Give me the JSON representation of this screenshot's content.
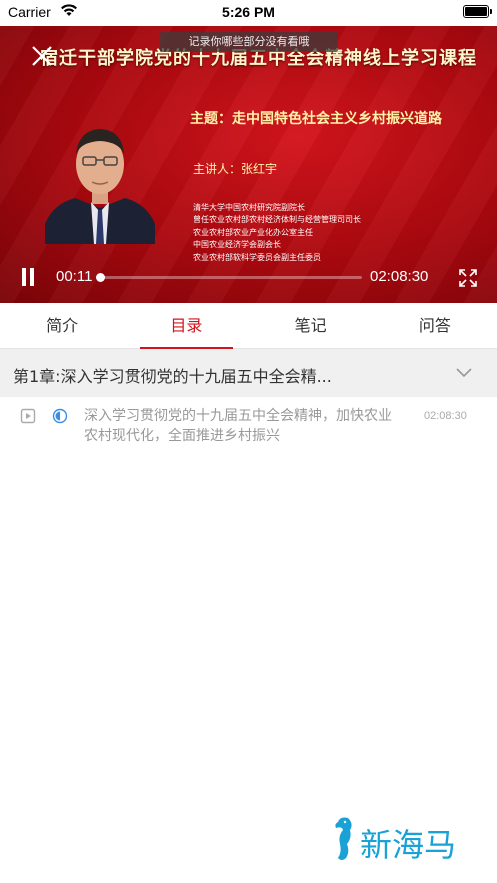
{
  "status_bar": {
    "carrier": "Carrier",
    "time": "5:26 PM"
  },
  "video": {
    "course_title": "宿迁干部学院党的十九届五中全会精神线上学习课程",
    "tip": "记录你哪些部分没有看哦",
    "theme": "主题：走中国特色社会主义乡村振兴道路",
    "speaker": "主讲人：张红宇",
    "bio": [
      "清华大学中国农村研究院副院长",
      "曾任农业农村部农村经济体制与经营管理司司长",
      "农业农村部农业产业化办公室主任",
      "中国农业经济学会副会长",
      "农业农村部软科学委员会副主任委员"
    ],
    "current_time": "00:11",
    "total_time": "02:08:30",
    "progress": 0.0015,
    "background_color": "#b80c14"
  },
  "tabs": [
    {
      "label": "简介",
      "active": false
    },
    {
      "label": "目录",
      "active": true
    },
    {
      "label": "笔记",
      "active": false
    },
    {
      "label": "问答",
      "active": false
    }
  ],
  "chapter": {
    "title": "第1章:深入学习贯彻党的十九届五中全会精..."
  },
  "lessons": [
    {
      "title": "深入学习贯彻党的十九届五中全会精神，加快农业农村现代化，全面推进乡村振兴",
      "duration": "02:08:30"
    }
  ],
  "watermark": {
    "text": "新海马"
  },
  "colors": {
    "accent": "#d0141c",
    "watermark": "#1aa2d6",
    "progress_icon": "#3a8ee6"
  }
}
